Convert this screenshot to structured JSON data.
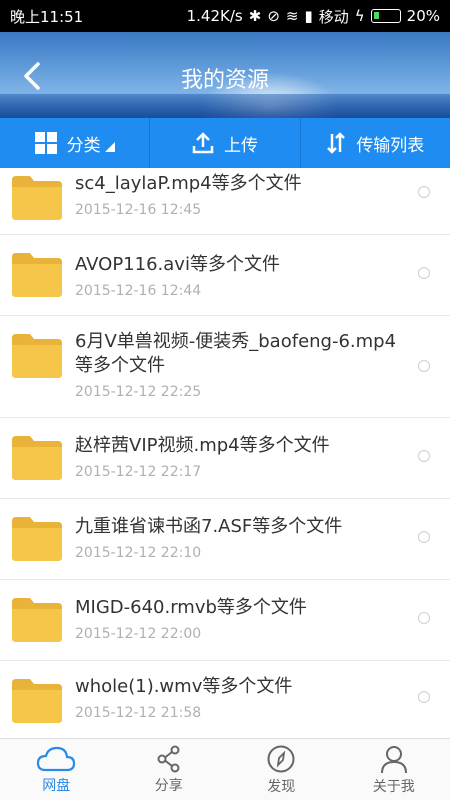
{
  "status_bar": {
    "time": "晚上11:51",
    "speed": "1.42K/s",
    "carrier": "移动",
    "battery": "20%"
  },
  "header": {
    "title": "我的资源"
  },
  "toolbar": {
    "category_label": "分类",
    "upload_label": "上传",
    "transfer_label": "传输列表"
  },
  "files": [
    {
      "title": "sc4_laylaP.mp4等多个文件",
      "date": "2015-12-16  12:45"
    },
    {
      "title": "AVOP116.avi等多个文件",
      "date": "2015-12-16  12:44"
    },
    {
      "title": "6月V单兽视频-便装秀_baofeng-6.mp4等多个文件",
      "date": "2015-12-12  22:25"
    },
    {
      "title": "赵梓茜VIP视频.mp4等多个文件",
      "date": "2015-12-12  22:17"
    },
    {
      "title": "九重谁省谏书函7.ASF等多个文件",
      "date": "2015-12-12  22:10"
    },
    {
      "title": "MIGD-640.rmvb等多个文件",
      "date": "2015-12-12  22:00"
    },
    {
      "title": "whole(1).wmv等多个文件",
      "date": "2015-12-12  21:58"
    }
  ],
  "bottom_nav": {
    "cloud_label": "网盘",
    "share_label": "分享",
    "discover_label": "发现",
    "about_label": "关于我"
  },
  "colors": {
    "accent": "#1e8cf0",
    "folder": "#f6c64a",
    "active_tab": "#2a8ae8"
  }
}
